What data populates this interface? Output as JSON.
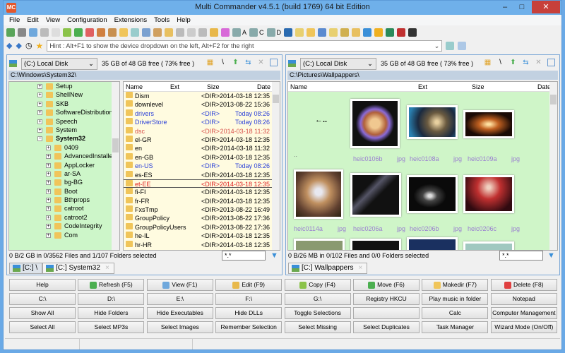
{
  "window": {
    "title": "Multi Commander v4.5.1 (build 1769) 64 bit Edition",
    "logo": "MC",
    "minimize": "–",
    "maximize": "□",
    "close": "✕"
  },
  "menu": [
    "File",
    "Edit",
    "View",
    "Configuration",
    "Extensions",
    "Tools",
    "Help"
  ],
  "toolbar": {
    "drive_labels": [
      "A",
      "C",
      "D"
    ]
  },
  "hint": {
    "text": "Hint : Alt+F1 to show the device dropdown on the left, Alt+F2 for the right"
  },
  "left": {
    "drive": "(C:) Local Disk",
    "free": "35 GB of 48 GB free ( 73% free )",
    "path": "C:\\Windows\\System32\\",
    "tree": [
      {
        "label": "Setup",
        "level": 0,
        "exp": "+"
      },
      {
        "label": "ShellNew",
        "level": 0,
        "exp": "+"
      },
      {
        "label": "SKB",
        "level": 0,
        "exp": "+"
      },
      {
        "label": "SoftwareDistribution",
        "level": 0,
        "exp": "+"
      },
      {
        "label": "Speech",
        "level": 0,
        "exp": "+"
      },
      {
        "label": "System",
        "level": 0,
        "exp": "+"
      },
      {
        "label": "System32",
        "level": 0,
        "exp": "−",
        "bold": true
      },
      {
        "label": "0409",
        "level": 1,
        "exp": "+"
      },
      {
        "label": "AdvancedInstallers",
        "level": 1,
        "exp": "+"
      },
      {
        "label": "AppLocker",
        "level": 1,
        "exp": "+"
      },
      {
        "label": "ar-SA",
        "level": 1,
        "exp": "+"
      },
      {
        "label": "bg-BG",
        "level": 1,
        "exp": "+"
      },
      {
        "label": "Boot",
        "level": 1,
        "exp": "+"
      },
      {
        "label": "Bthprops",
        "level": 1,
        "exp": "+"
      },
      {
        "label": "catroot",
        "level": 1,
        "exp": "+"
      },
      {
        "label": "catroot2",
        "level": 1,
        "exp": "+"
      },
      {
        "label": "CodeIntegrity",
        "level": 1,
        "exp": "+"
      },
      {
        "label": "Com",
        "level": 1,
        "exp": "+"
      }
    ],
    "columns": {
      "name": "Name",
      "ext": "Ext",
      "size": "Size",
      "date": "Date"
    },
    "files": [
      {
        "name": "Dism",
        "size": "<DIR>",
        "date": "2014-03-18 12:35",
        "color": "#000"
      },
      {
        "name": "downlevel",
        "size": "<DIR>",
        "date": "2013-08-22 15:36",
        "color": "#000"
      },
      {
        "name": "drivers",
        "size": "<DIR>",
        "date": "Today 08:26",
        "color": "#2a3fd8"
      },
      {
        "name": "DriverStore",
        "size": "<DIR>",
        "date": "Today 08:26",
        "color": "#2a3fd8"
      },
      {
        "name": "dsc",
        "size": "<DIR>",
        "date": "2014-03-18 11:32",
        "color": "#d8504a"
      },
      {
        "name": "el-GR",
        "size": "<DIR>",
        "date": "2014-03-18 12:35",
        "color": "#000"
      },
      {
        "name": "en",
        "size": "<DIR>",
        "date": "2014-03-18 11:32",
        "color": "#000"
      },
      {
        "name": "en-GB",
        "size": "<DIR>",
        "date": "2014-03-18 12:35",
        "color": "#000"
      },
      {
        "name": "en-US",
        "size": "<DIR>",
        "date": "Today 08:26",
        "color": "#2a3fd8"
      },
      {
        "name": "es-ES",
        "size": "<DIR>",
        "date": "2014-03-18 12:35",
        "color": "#000"
      },
      {
        "name": "et-EE",
        "size": "<DIR>",
        "date": "2014-03-18 12:35",
        "color": "#e02020",
        "focused": true
      },
      {
        "name": "fi-FI",
        "size": "<DIR>",
        "date": "2014-03-18 12:35",
        "color": "#000"
      },
      {
        "name": "fr-FR",
        "size": "<DIR>",
        "date": "2014-03-18 12:35",
        "color": "#000"
      },
      {
        "name": "FxsTmp",
        "size": "<DIR>",
        "date": "2013-08-22 16:49",
        "color": "#000"
      },
      {
        "name": "GroupPolicy",
        "size": "<DIR>",
        "date": "2013-08-22 17:36",
        "color": "#000"
      },
      {
        "name": "GroupPolicyUsers",
        "size": "<DIR>",
        "date": "2013-08-22 17:36",
        "color": "#000"
      },
      {
        "name": "he-IL",
        "size": "<DIR>",
        "date": "2014-03-18 12:35",
        "color": "#000"
      },
      {
        "name": "hr-HR",
        "size": "<DIR>",
        "date": "2014-03-18 12:35",
        "color": "#000"
      }
    ],
    "status": "0 B/2 GB in 0/3562 Files and 1/107 Folders selected",
    "filter": "*.*",
    "tabs": [
      {
        "label": "[C:] \\",
        "active": false
      },
      {
        "label": "[C:] System32",
        "active": true
      }
    ]
  },
  "right": {
    "drive": "(C:) Local Disk",
    "free": "35 GB of 48 GB free ( 73% free )",
    "path": "C:\\Pictures\\Wallpappers\\",
    "columns": {
      "name": "Name",
      "ext": "Ext",
      "size": "Size",
      "date": "Date"
    },
    "up": {
      "arrow": "←..",
      "label": ".."
    },
    "thumbs": [
      {
        "name": "heic0106b",
        "ext": "jpg",
        "bg": "radial-gradient(circle,#f0c890 15%,#b0603a 35%,#8a6ad8 45%,#111 60%)"
      },
      {
        "name": "heic0108a",
        "ext": "jpg",
        "bg": "radial-gradient(circle at 60% 50%,#e8d0a0 5%,#6a5a40 30%,#1a2a40 60%,#2a80b0 90%)"
      },
      {
        "name": "heic0109a",
        "ext": "jpg",
        "bg": "radial-gradient(ellipse,#ffe0a0 5%,#c06020 30%,#1a0a05 70%)"
      },
      {
        "name": "heic0114a",
        "ext": "jpg",
        "bg": "radial-gradient(circle at 50% 45%,#e8e8f0 10%,#c09060 35%,#604030 70%,#2a2010)"
      },
      {
        "name": "heic0206a",
        "ext": "jpg",
        "bg": "linear-gradient(135deg,#111 30%,#556 40%,#111 55%)"
      },
      {
        "name": "heic0206b",
        "ext": "jpg",
        "bg": "radial-gradient(ellipse at 45% 55%,#ddd 5%,#444 20%,#0a0a0a 45%)"
      },
      {
        "name": "heic0206c",
        "ext": "jpg",
        "bg": "radial-gradient(ellipse at 50% 30%,#f0d0c0 5%,#c03030 35%,#300a10 80%)"
      }
    ],
    "status": "0 B/26 MB in 0/102 Files and 0/0 Folders selected",
    "filter": "*.*",
    "tabs": [
      {
        "label": "[C:] Wallpappers",
        "active": true
      }
    ]
  },
  "buttons": [
    [
      "Help",
      "Refresh (F5)",
      "View (F1)",
      "Edit (F9)",
      "Copy (F4)",
      "Move (F6)",
      "Makedir (F7)",
      "Delete (F8)"
    ],
    [
      "C:\\",
      "D:\\",
      "E:\\",
      "F:\\",
      "G:\\",
      "Registry HKCU",
      "Play music in folder",
      "Notepad"
    ],
    [
      "Show All",
      "Hide Folders",
      "Hide Executables",
      "Hide DLLs",
      "Toggle Selections",
      "",
      "Calc",
      "Computer Management"
    ],
    [
      "Select All",
      "Select MP3s",
      "Select Images",
      "Remember Selection",
      "Select Missing",
      "Select Duplicates",
      "Task Manager",
      "Wizard Mode (On/Off)"
    ]
  ],
  "button_icons": {
    "Refresh (F5)": "#4caf50",
    "View (F1)": "#6fa8dc",
    "Edit (F9)": "#e8b84a",
    "Copy (F4)": "#8bc34a",
    "Move (F6)": "#4caf50",
    "Makedir (F7)": "#f0c55a",
    "Delete (F8)": "#e04040"
  },
  "colors": {
    "tree_bg": "#cdf6c9",
    "list_bg": "#fffbe0",
    "accent": "#3a8fd8"
  }
}
